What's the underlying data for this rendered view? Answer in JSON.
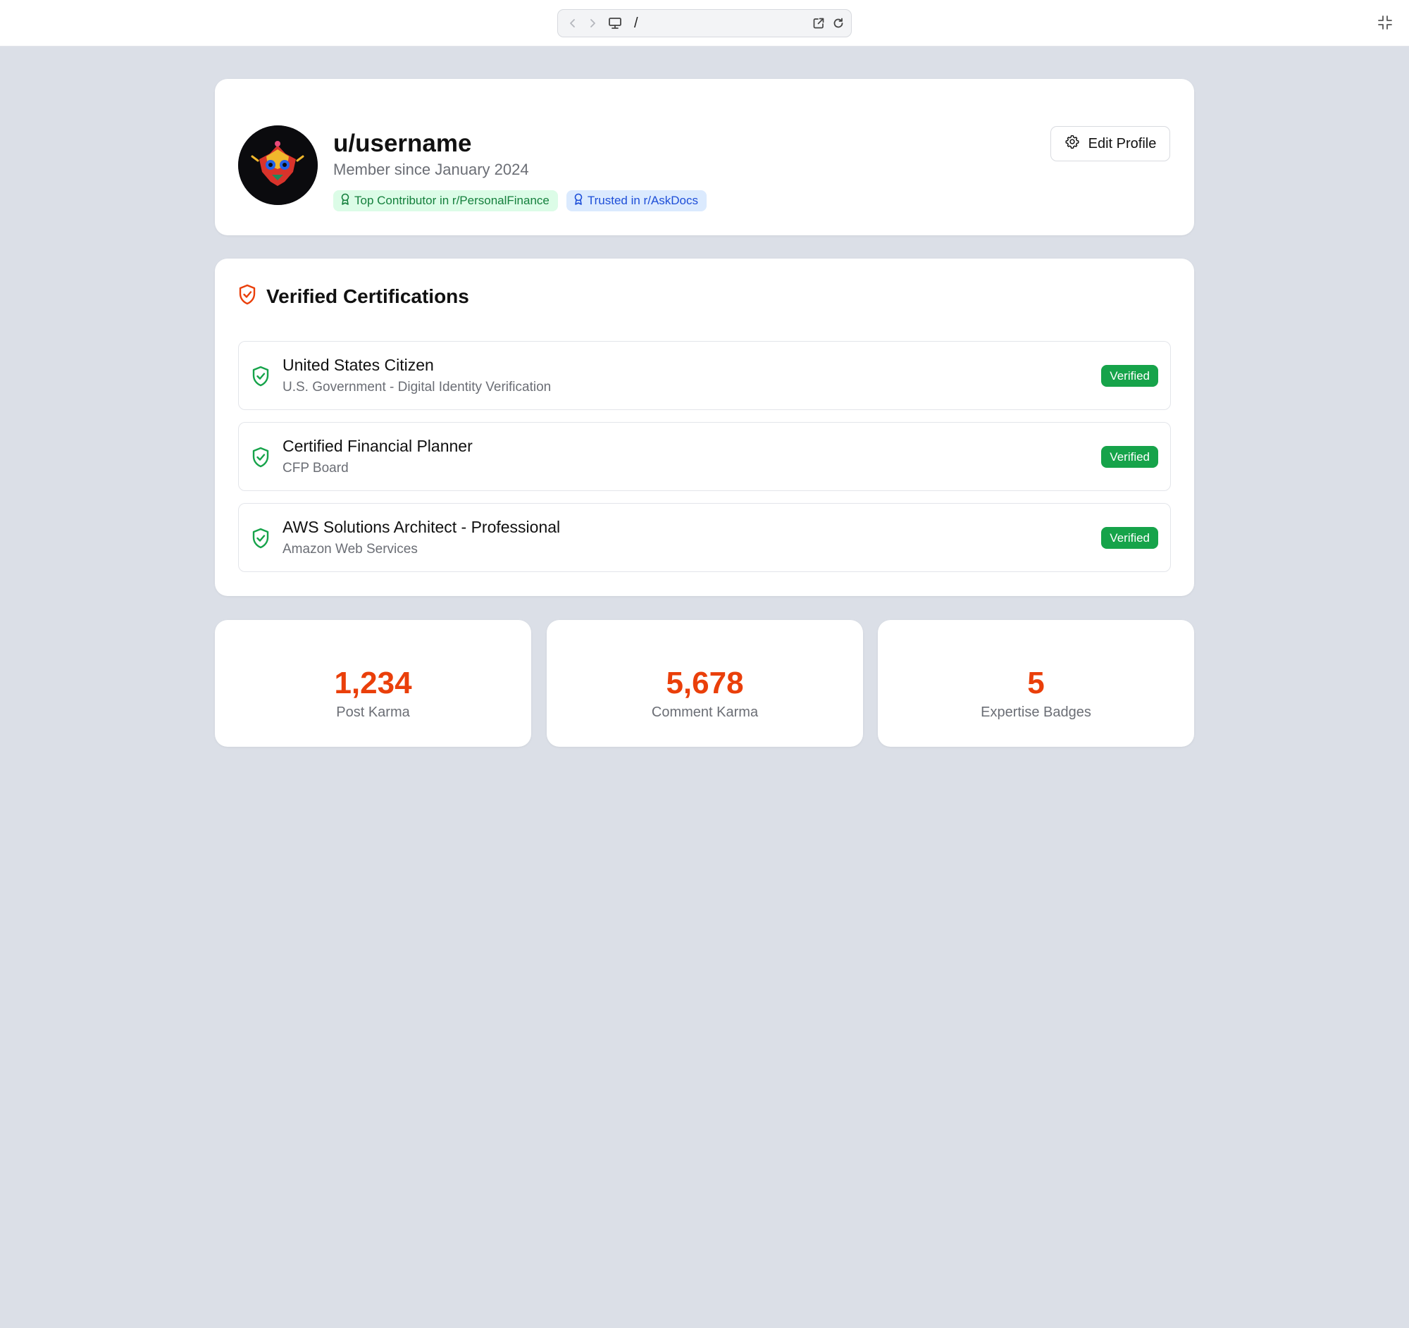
{
  "browser": {
    "path": "/"
  },
  "profile": {
    "username": "u/username",
    "member_since": "Member since January 2024",
    "badges": [
      {
        "label": "Top Contributor in r/PersonalFinance",
        "color": "#15803d"
      },
      {
        "label": "Trusted in r/AskDocs",
        "color": "#1d4ed8"
      }
    ],
    "edit_label": "Edit Profile"
  },
  "certifications": {
    "title": "Verified Certifications",
    "items": [
      {
        "name": "United States Citizen",
        "issuer": "U.S. Government - Digital Identity Verification",
        "status": "Verified"
      },
      {
        "name": "Certified Financial Planner",
        "issuer": "CFP Board",
        "status": "Verified"
      },
      {
        "name": "AWS Solutions Architect - Professional",
        "issuer": "Amazon Web Services",
        "status": "Verified"
      }
    ]
  },
  "stats": [
    {
      "value": "1,234",
      "label": "Post Karma"
    },
    {
      "value": "5,678",
      "label": "Comment Karma"
    },
    {
      "value": "5",
      "label": "Expertise Badges"
    }
  ],
  "colors": {
    "accent": "#ea3f0a",
    "verified": "#16a34a",
    "background": "#dbdfe7"
  }
}
